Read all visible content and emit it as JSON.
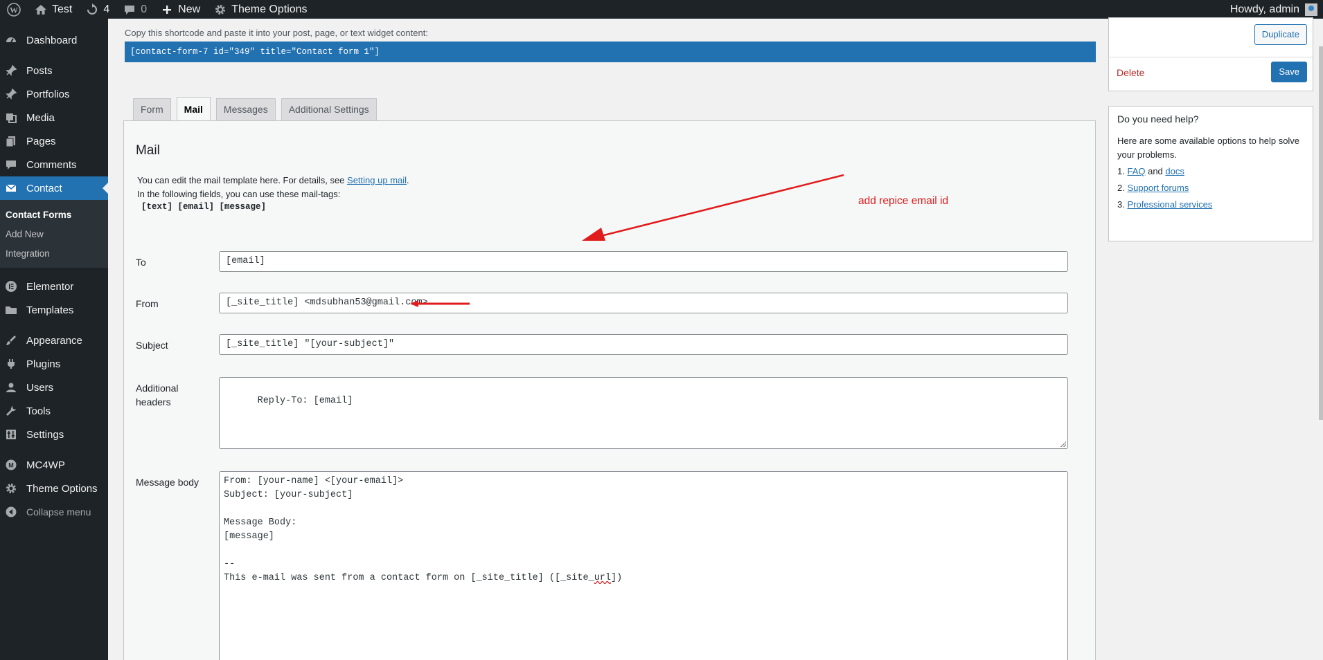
{
  "adminbar": {
    "site_name": "Test",
    "updates_count": "4",
    "comments_count": "0",
    "new_label": "New",
    "theme_options_label": "Theme Options",
    "greeting": "Howdy, admin"
  },
  "sidebar": {
    "items": [
      {
        "label": "Dashboard",
        "icon": "dashboard-icon"
      },
      {
        "label": "Posts",
        "icon": "pin-icon"
      },
      {
        "label": "Portfolios",
        "icon": "pin-icon"
      },
      {
        "label": "Media",
        "icon": "media-icon"
      },
      {
        "label": "Pages",
        "icon": "pages-icon"
      },
      {
        "label": "Comments",
        "icon": "comment-icon"
      },
      {
        "label": "Contact",
        "icon": "envelope-icon"
      },
      {
        "label": "Elementor",
        "icon": "elementor-icon"
      },
      {
        "label": "Templates",
        "icon": "folder-icon"
      },
      {
        "label": "Appearance",
        "icon": "brush-icon"
      },
      {
        "label": "Plugins",
        "icon": "plug-icon"
      },
      {
        "label": "Users",
        "icon": "user-icon"
      },
      {
        "label": "Tools",
        "icon": "wrench-icon"
      },
      {
        "label": "Settings",
        "icon": "settings-icon"
      },
      {
        "label": "MC4WP",
        "icon": "mc4wp-icon"
      },
      {
        "label": "Theme Options",
        "icon": "gear-icon"
      }
    ],
    "submenu": [
      "Contact Forms",
      "Add New",
      "Integration"
    ],
    "collapse_label": "Collapse menu"
  },
  "shortcode": {
    "label": "Copy this shortcode and paste it into your post, page, or text widget content:",
    "code": "[contact-form-7 id=\"349\" title=\"Contact form 1\"]"
  },
  "tabs": [
    "Form",
    "Mail",
    "Messages",
    "Additional Settings"
  ],
  "mail": {
    "heading": "Mail",
    "desc_before_link": "You can edit the mail template here. For details, see ",
    "desc_link": "Setting up mail",
    "desc_after_link": ".",
    "desc_line2": "In the following fields, you can use these mail-tags:",
    "tags": "[text] [email] [message]",
    "to_label": "To",
    "to_value": "[email]",
    "from_label": "From",
    "from_prefix": "[_site_title] <mdsubhan",
    "from_suffix": "53@gmail.com>",
    "subject_label": "Subject",
    "subject_value": "[_site_title] \"[your-subject]\"",
    "headers_label_1": "Additional",
    "headers_label_2": "headers",
    "headers_value": "Reply-To: [email]",
    "body_label": "Message body",
    "body_lines": [
      "From: [your-name] <[your-email]>",
      "Subject: [your-subject]",
      "",
      "Message Body:",
      "[message]",
      "",
      "--"
    ],
    "body_last_prefix": "This e-mail was sent from a contact form on [_site_title] ([_site_",
    "body_last_squiggle": "url",
    "body_last_suffix": "])"
  },
  "annotation": {
    "text": "add repice email id",
    "color": "#e01b1b"
  },
  "actions": {
    "duplicate": "Duplicate",
    "delete": "Delete",
    "save": "Save"
  },
  "help": {
    "title": "Do you need help?",
    "text": "Here are some available options to help solve your problems.",
    "items": [
      {
        "num": "1.",
        "link1": "FAQ",
        "mid": " and ",
        "link2": "docs"
      },
      {
        "num": "2.",
        "link1": "Support forums"
      },
      {
        "num": "3.",
        "link1": "Professional services"
      }
    ]
  }
}
